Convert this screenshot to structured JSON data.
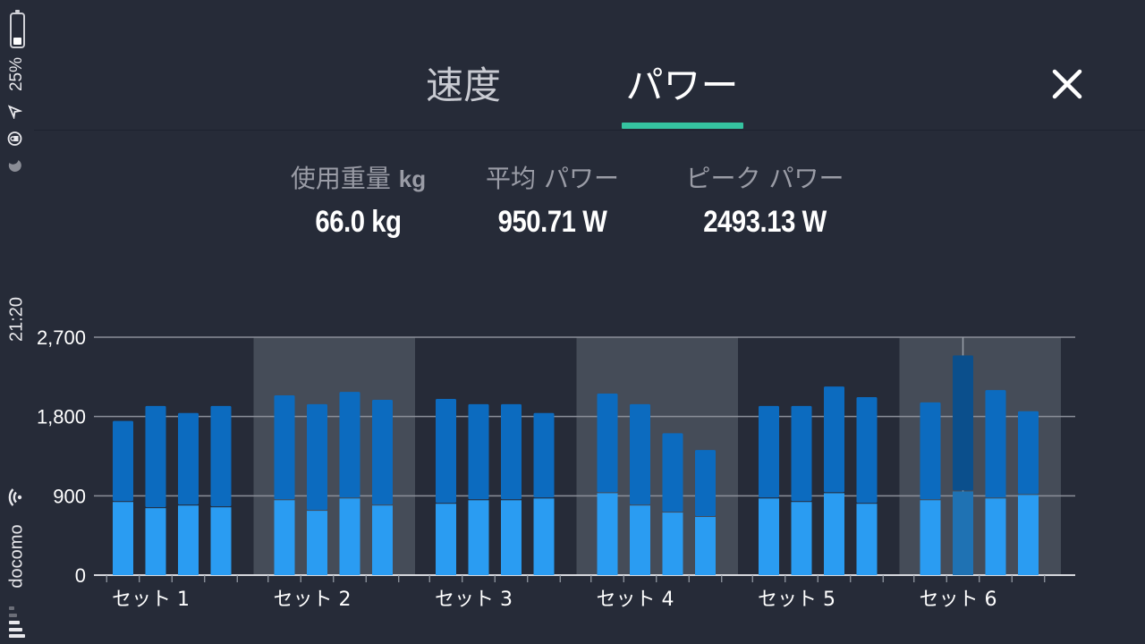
{
  "status_bar": {
    "battery": "25%",
    "battery_level": 0.25,
    "time": "21:20",
    "carrier": "docomo"
  },
  "tabs": [
    {
      "label": "速度",
      "selected": false
    },
    {
      "label": "パワー",
      "selected": true
    }
  ],
  "stats": {
    "weight_label": "使用重量",
    "weight_unit": "kg",
    "weight_value": "66.0 kg",
    "avg_label": "平均 パワー",
    "avg_value": "950.71 W",
    "peak_label": "ピーク パワー",
    "peak_value": "2493.13 W"
  },
  "colors": {
    "background": "#262b38",
    "tab_underline": "#35c3a0",
    "bar_peak": "#0c6bbf",
    "bar_avg": "#2a9cf2",
    "bar_selected_peak": "#0b4f8c",
    "bar_selected_avg": "#1f72b3",
    "band": "#454c58"
  },
  "chart_data": {
    "type": "bar",
    "ylim": [
      0,
      2700
    ],
    "yticks": [
      "0",
      "900",
      "1,800",
      "2,700"
    ],
    "ytick_values": [
      0,
      900,
      1800,
      2700
    ],
    "categories": [
      "セット 1",
      "セット 2",
      "セット 3",
      "セット 4",
      "セット 5",
      "セット 6"
    ],
    "selected": {
      "set": 5,
      "rep": 1
    },
    "series": [
      {
        "values": [
          [
            1750,
            1920,
            1840,
            1920
          ],
          [
            2040,
            1940,
            2080,
            1990
          ],
          [
            2000,
            1940,
            1940,
            1840
          ],
          [
            2060,
            1940,
            1610,
            1420
          ],
          [
            1920,
            1920,
            2140,
            2020
          ],
          [
            1960,
            2493,
            2100,
            1860
          ]
        ]
      },
      {
        "values": [
          [
            840,
            770,
            800,
            780
          ],
          [
            860,
            740,
            880,
            800
          ],
          [
            820,
            860,
            860,
            880
          ],
          [
            940,
            800,
            720,
            670
          ],
          [
            880,
            840,
            940,
            820
          ],
          [
            860,
            960,
            880,
            920
          ]
        ]
      }
    ]
  }
}
